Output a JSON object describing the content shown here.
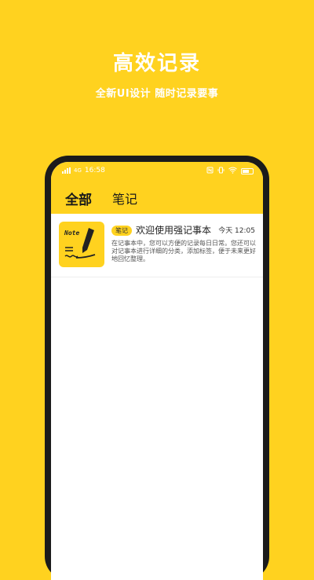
{
  "promo": {
    "title": "高效记录",
    "subtitle": "全新UI设计 随时记录要事"
  },
  "status_bar": {
    "network": "4G",
    "time": "16:58",
    "right_icons": [
      "nfc-icon",
      "vibrate-icon",
      "wifi-icon",
      "battery-icon"
    ]
  },
  "tabs": [
    {
      "label": "全部",
      "active": true
    },
    {
      "label": "笔记",
      "active": false
    }
  ],
  "notes": [
    {
      "thumbnail_text": "Note",
      "category": "笔记",
      "title": "欢迎使用强记事本",
      "time": "今天 12:05",
      "body": "在记事本中，您可以方便的记录每日日常。您还可以对记事本进行详细的分类，添加标签，便于未来更好地回忆整理。"
    }
  ],
  "colors": {
    "brand_yellow": "#FFD21F",
    "phone_frame": "#1b1b1b",
    "text_dark": "#222222"
  }
}
